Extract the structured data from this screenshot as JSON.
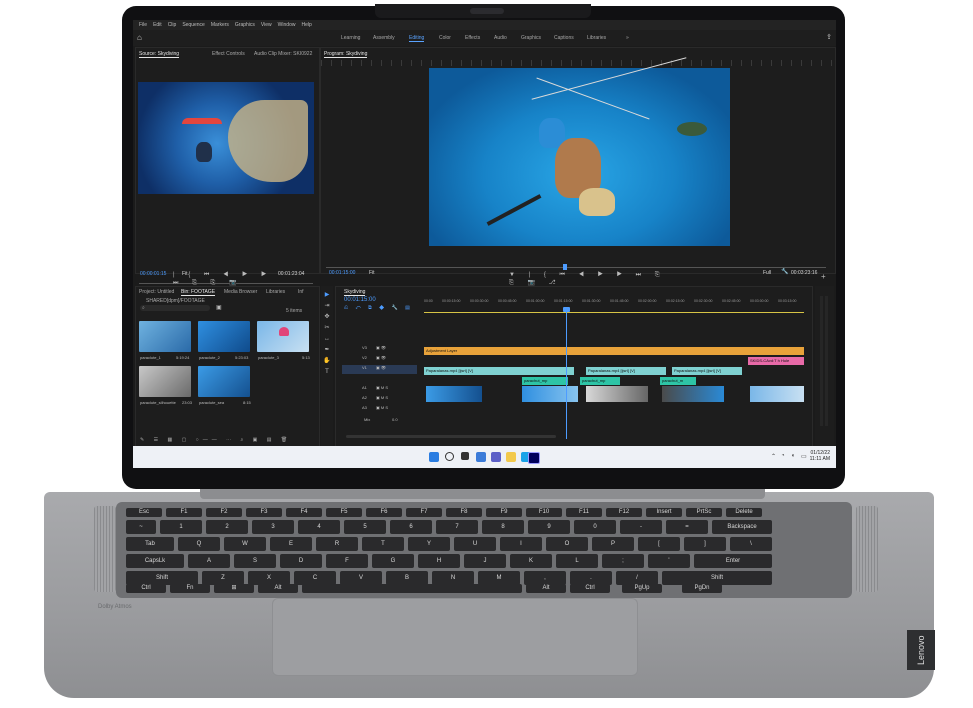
{
  "menu": {
    "items": [
      "File",
      "Edit",
      "Clip",
      "Sequence",
      "Markers",
      "Graphics",
      "View",
      "Window",
      "Help"
    ]
  },
  "workspaces": {
    "items": [
      "Learning",
      "Assembly",
      "Editing",
      "Color",
      "Effects",
      "Audio",
      "Graphics",
      "Captions",
      "Libraries"
    ],
    "active": "Editing"
  },
  "source_panel": {
    "tabs": [
      "Source: Skydiving",
      "Effect Controls",
      "Audio Clip Mixer: SKI0922"
    ],
    "timecode_in": "00:00:01:15",
    "fit_label": "Fit",
    "timecode_duration": "00:01:23:04"
  },
  "program_panel": {
    "tab": "Program: Skydiving",
    "timecode_in": "00:01:15:00",
    "fit_label": "Fit",
    "quality_label": "Full",
    "timecode_duration": "00:03:23:16"
  },
  "project_panel": {
    "tabs": [
      "Project: Untitled",
      "Bin: FOOTAGE",
      "Media Browser",
      "Libraries",
      "Inf"
    ],
    "path": "SHARED[dpm]/FOOTAGE",
    "item_count": "5 items",
    "items": [
      {
        "name": "paraclute_1",
        "duration": "5:19:24"
      },
      {
        "name": "paraclute_2",
        "duration": "5:23:03"
      },
      {
        "name": "paraclute_3",
        "duration": "5:13"
      },
      {
        "name": "paraclute_silhouette",
        "duration": "23:03"
      },
      {
        "name": "paraclute_sea",
        "duration": "8:15"
      }
    ]
  },
  "timeline": {
    "tab": "Skydiving",
    "timecode": "00:01:15:00",
    "ruler": [
      "00:00",
      "00:00:15:00",
      "00:00:30:00",
      "00:00:45:00",
      "00:01:00:00",
      "00:01:15:00",
      "00:01:30:00",
      "00:01:45:00",
      "00:02:00:00",
      "00:02:15:00",
      "00:02:30:00",
      "00:02:45:00",
      "00:03:00:00",
      "00:03:15:00"
    ],
    "tracks": [
      "V3",
      "V2",
      "V1",
      "A1",
      "A2",
      "A3",
      "Mix"
    ],
    "mix_value": "0.0",
    "clips": {
      "adjustment": "Adjustment Layer",
      "title_clip": "SKIDS-CAvd:T h Hule",
      "v1_a": "Paparalanas.mp4 [ijsrt] [V]",
      "v1_b": "Paparalanas.mp4 [ijsrt] [V]",
      "v1_c": "Paparalanas.mp4 [ijsrt] [V]",
      "a_a": "parachut_mp",
      "a_b": "parachut_mp",
      "a_c": "parachut_m"
    }
  },
  "taskbar": {
    "date": "01/12/22",
    "time": "11:11 AM"
  },
  "laptop": {
    "brand": "Lenovo",
    "audio_badge": "Dolby Atmos"
  },
  "keyboard": {
    "row1": [
      "Esc",
      "F1",
      "F2",
      "F3",
      "F4",
      "F5",
      "F6",
      "F7",
      "F8",
      "F9",
      "F10",
      "F11",
      "F12",
      "Insert",
      "PrtSc",
      "Delete"
    ],
    "row2": [
      "~",
      "1",
      "2",
      "3",
      "4",
      "5",
      "6",
      "7",
      "8",
      "9",
      "0",
      "-",
      "=",
      "Backspace"
    ],
    "row3": [
      "Tab",
      "Q",
      "W",
      "E",
      "R",
      "T",
      "Y",
      "U",
      "I",
      "O",
      "P",
      "[",
      "]",
      "\\"
    ],
    "row4": [
      "CapsLk",
      "A",
      "S",
      "D",
      "F",
      "G",
      "H",
      "J",
      "K",
      "L",
      ";",
      "'",
      "Enter"
    ],
    "row5": [
      "Shift",
      "Z",
      "X",
      "C",
      "V",
      "B",
      "N",
      "M",
      ",",
      ".",
      "/",
      "Shift"
    ],
    "row6": [
      "Ctrl",
      "Fn",
      "⊞",
      "Alt",
      "",
      "Alt",
      "Ctrl",
      "PgUp",
      "PgDn"
    ]
  },
  "colors": {
    "accent_blue": "#4d9cff",
    "clip_yellow": "#e8a23a",
    "clip_teal": "#7fd1d1",
    "clip_pink": "#e86aa8"
  }
}
